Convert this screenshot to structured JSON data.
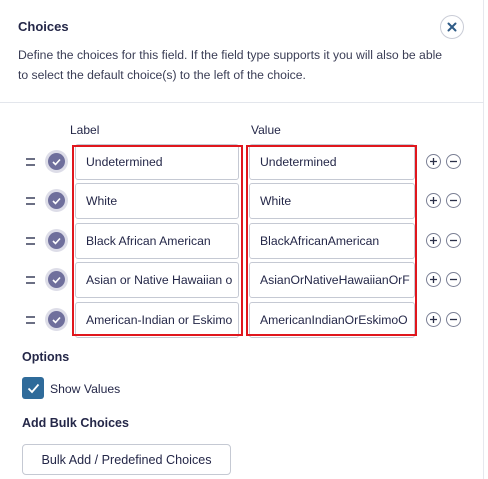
{
  "header": {
    "title": "Choices",
    "description": "Define the choices for this field. If the field type supports it you will also be able to select the default choice(s) to the left of the choice."
  },
  "columns": {
    "label": "Label",
    "value": "Value"
  },
  "choices": [
    {
      "label": "Undetermined",
      "value": "Undetermined"
    },
    {
      "label": "White",
      "value": "White"
    },
    {
      "label": "Black African American",
      "value": "BlackAfricanAmerican"
    },
    {
      "label": "Asian or Native Hawaiian o",
      "value": "AsianOrNativeHawaiianOrF"
    },
    {
      "label": "American-Indian or Eskimo",
      "value": "AmericanIndianOrEskimoO"
    }
  ],
  "options": {
    "title": "Options",
    "show_values_label": "Show Values",
    "show_values_checked": true
  },
  "bulk": {
    "title": "Add Bulk Choices",
    "button_label": "Bulk Add / Predefined Choices"
  },
  "colors": {
    "accent": "#2f6b9a",
    "highlight": "#e0161d",
    "radio": "#6f6f9c"
  }
}
